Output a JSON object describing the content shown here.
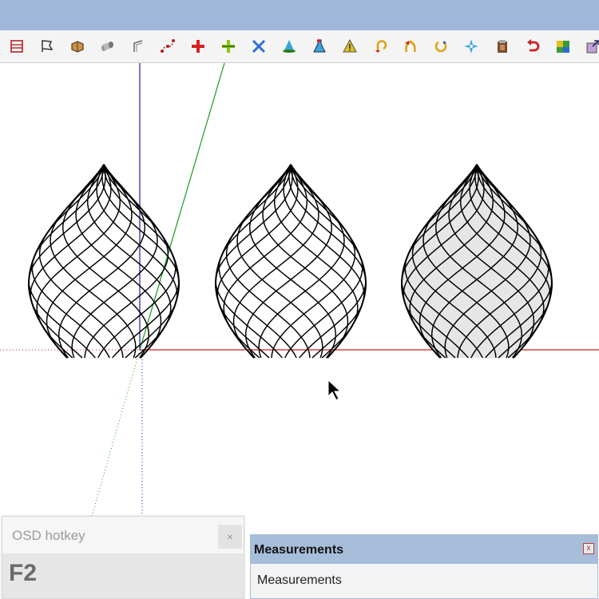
{
  "toolbar": {
    "tools": [
      {
        "icon": "layers-icon"
      },
      {
        "icon": "flag-icon"
      },
      {
        "icon": "box-icon"
      },
      {
        "icon": "cylinder-icon"
      },
      {
        "icon": "offset-edge-icon"
      },
      {
        "icon": "curve-points-icon"
      },
      {
        "icon": "add-cross-icon"
      },
      {
        "icon": "plus-split-icon"
      },
      {
        "icon": "delete-x-icon"
      },
      {
        "icon": "cone-icon"
      },
      {
        "icon": "flask-icon"
      },
      {
        "icon": "warning-triangle-icon"
      },
      {
        "icon": "rotate-hook-icon"
      },
      {
        "icon": "bend-arrow-icon"
      },
      {
        "icon": "cycle-icon"
      },
      {
        "icon": "move-star-icon"
      },
      {
        "icon": "paste-icon"
      },
      {
        "icon": "undo-arrow-icon"
      },
      {
        "icon": "puzzle-icon"
      },
      {
        "icon": "export-icon"
      }
    ]
  },
  "colors": {
    "axis_red": "#cc2020",
    "axis_green": "#1a9a1a",
    "axis_blue": "#1a1aa8",
    "mesh": "#000000",
    "shade": "#e6e6e6"
  },
  "osd": {
    "title": "OSD hotkey",
    "close": "×",
    "key": "F2"
  },
  "measurements": {
    "title": "Measurements",
    "close": "x",
    "label": "Measurements"
  }
}
